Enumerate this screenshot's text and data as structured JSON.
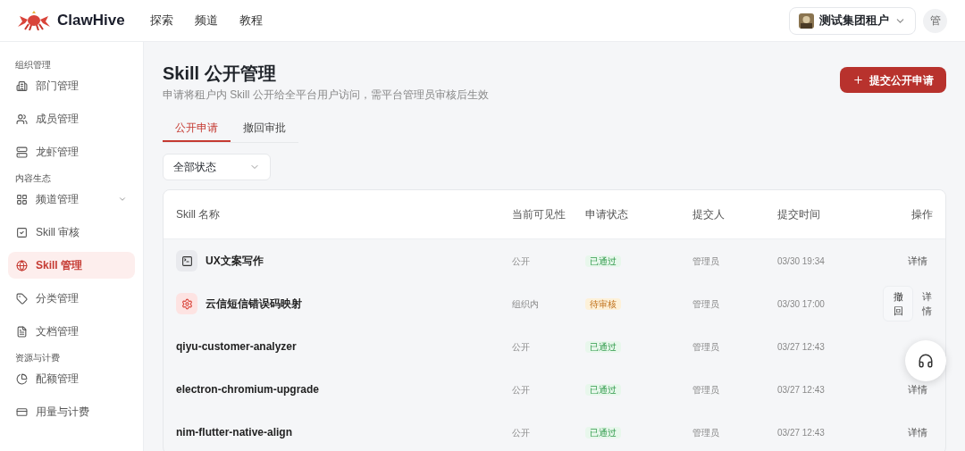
{
  "header": {
    "brand": "ClawHive",
    "nav": [
      {
        "label": "探索"
      },
      {
        "label": "频道"
      },
      {
        "label": "教程"
      }
    ],
    "tenant": "测试集团租户",
    "user_avatar": "管"
  },
  "sidebar": {
    "groups": [
      {
        "title": "组织管理",
        "items": [
          {
            "label": "部门管理",
            "kind": "building",
            "selected": false
          },
          {
            "label": "成员管理",
            "kind": "users",
            "selected": false
          },
          {
            "label": "龙虾管理",
            "kind": "server",
            "selected": false
          }
        ]
      },
      {
        "title": "内容生态",
        "items": [
          {
            "label": "频道管理",
            "kind": "grid",
            "selected": false,
            "expandable": true
          },
          {
            "label": "Skill 审核",
            "kind": "check",
            "selected": false
          },
          {
            "label": "Skill 管理",
            "kind": "globe",
            "selected": true
          },
          {
            "label": "分类管理",
            "kind": "tag",
            "selected": false
          },
          {
            "label": "文档管理",
            "kind": "file",
            "selected": false
          }
        ]
      },
      {
        "title": "资源与计费",
        "items": [
          {
            "label": "配额管理",
            "kind": "pie",
            "selected": false
          },
          {
            "label": "用量与计费",
            "kind": "card",
            "selected": false
          }
        ]
      }
    ]
  },
  "page": {
    "title": "Skill 公开管理",
    "subtitle": "申请将租户内 Skill 公开给全平台用户访问，需平台管理员审核后生效",
    "primary_button": "提交公开申请",
    "tabs": [
      {
        "label": "公开申请",
        "selected": true
      },
      {
        "label": "撤回审批",
        "selected": false
      }
    ],
    "filter": "全部状态",
    "table": {
      "columns": [
        "Skill 名称",
        "当前可见性",
        "申请状态",
        "提交人",
        "提交时间",
        "操作"
      ],
      "rows": [
        {
          "kind": "terminal",
          "name": "UX文案写作",
          "visibility": "公开",
          "status": {
            "label": "已通过",
            "kind": "approved"
          },
          "submitter": "管理员",
          "time": "03/30 19:34",
          "actions": [
            "详情"
          ]
        },
        {
          "kind": "gear",
          "name": "云信短信错误码映射",
          "visibility": "组织内",
          "status": {
            "label": "待审核",
            "kind": "pending"
          },
          "submitter": "管理员",
          "time": "03/30 17:00",
          "actions": [
            "撤回",
            "详情"
          ]
        },
        {
          "name": "qiyu-customer-analyzer",
          "visibility": "公开",
          "status": {
            "label": "已通过",
            "kind": "approved"
          },
          "submitter": "管理员",
          "time": "03/27 12:43",
          "actions": []
        },
        {
          "name": "electron-chromium-upgrade",
          "visibility": "公开",
          "status": {
            "label": "已通过",
            "kind": "approved"
          },
          "submitter": "管理员",
          "time": "03/27 12:43",
          "actions": [
            "详情"
          ]
        },
        {
          "name": "nim-flutter-native-align",
          "visibility": "公开",
          "status": {
            "label": "已通过",
            "kind": "approved"
          },
          "submitter": "管理员",
          "time": "03/27 12:43",
          "actions": [
            "详情"
          ]
        }
      ]
    }
  }
}
